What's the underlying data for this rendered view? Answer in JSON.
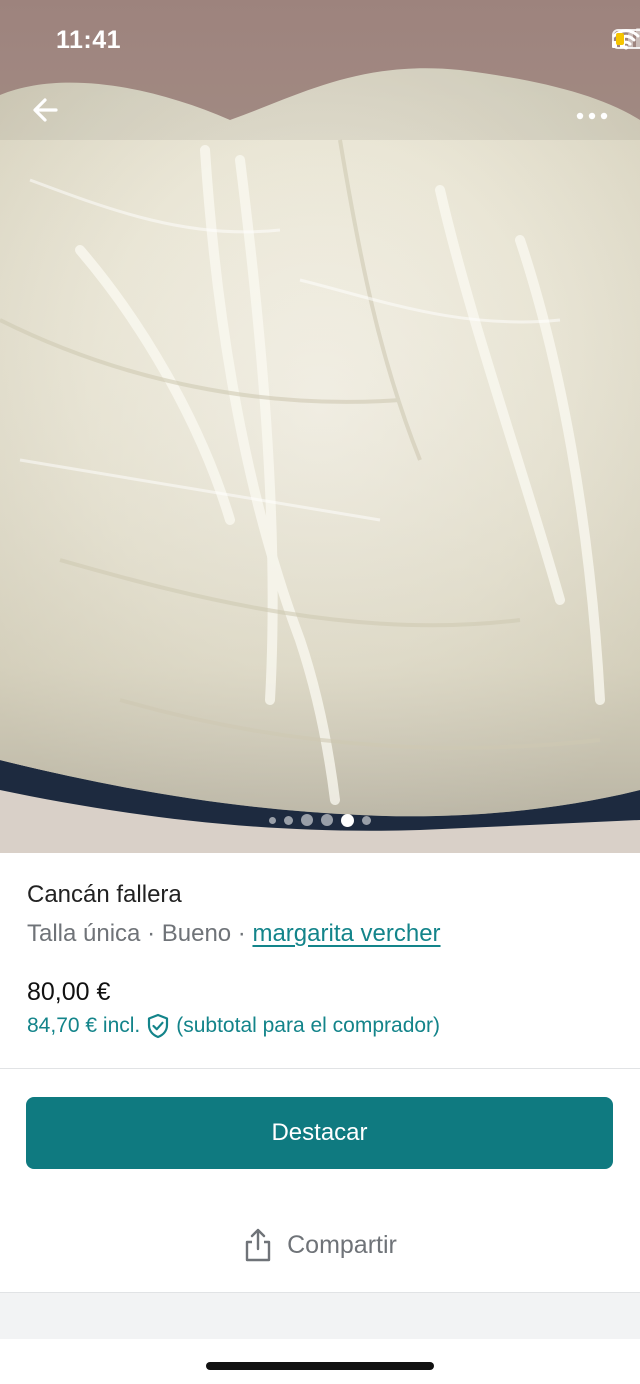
{
  "status_bar": {
    "time": "11:41",
    "icons": [
      "signal-icon",
      "wifi-icon",
      "battery-icon"
    ],
    "battery_color": "#f5c400"
  },
  "nav": {
    "back_icon": "arrow-left-icon",
    "more_icon": "more-dots-icon"
  },
  "gallery": {
    "photo_count": 6,
    "active_index": 4
  },
  "product": {
    "title": "Cancán fallera",
    "size": "Talla única",
    "separator_1": " · ",
    "condition": "Bueno",
    "separator_2": " · ",
    "seller": "margarita vercher",
    "price": "80,00 €",
    "price_incl": "84,70 € incl.",
    "price_incl_note": "(subtotal para el comprador)"
  },
  "actions": {
    "primary_label": "Destacar",
    "share_label": "Compartir"
  },
  "colors": {
    "accent": "#0f7a80",
    "link": "#13848a",
    "muted_text": "#6f7378"
  }
}
